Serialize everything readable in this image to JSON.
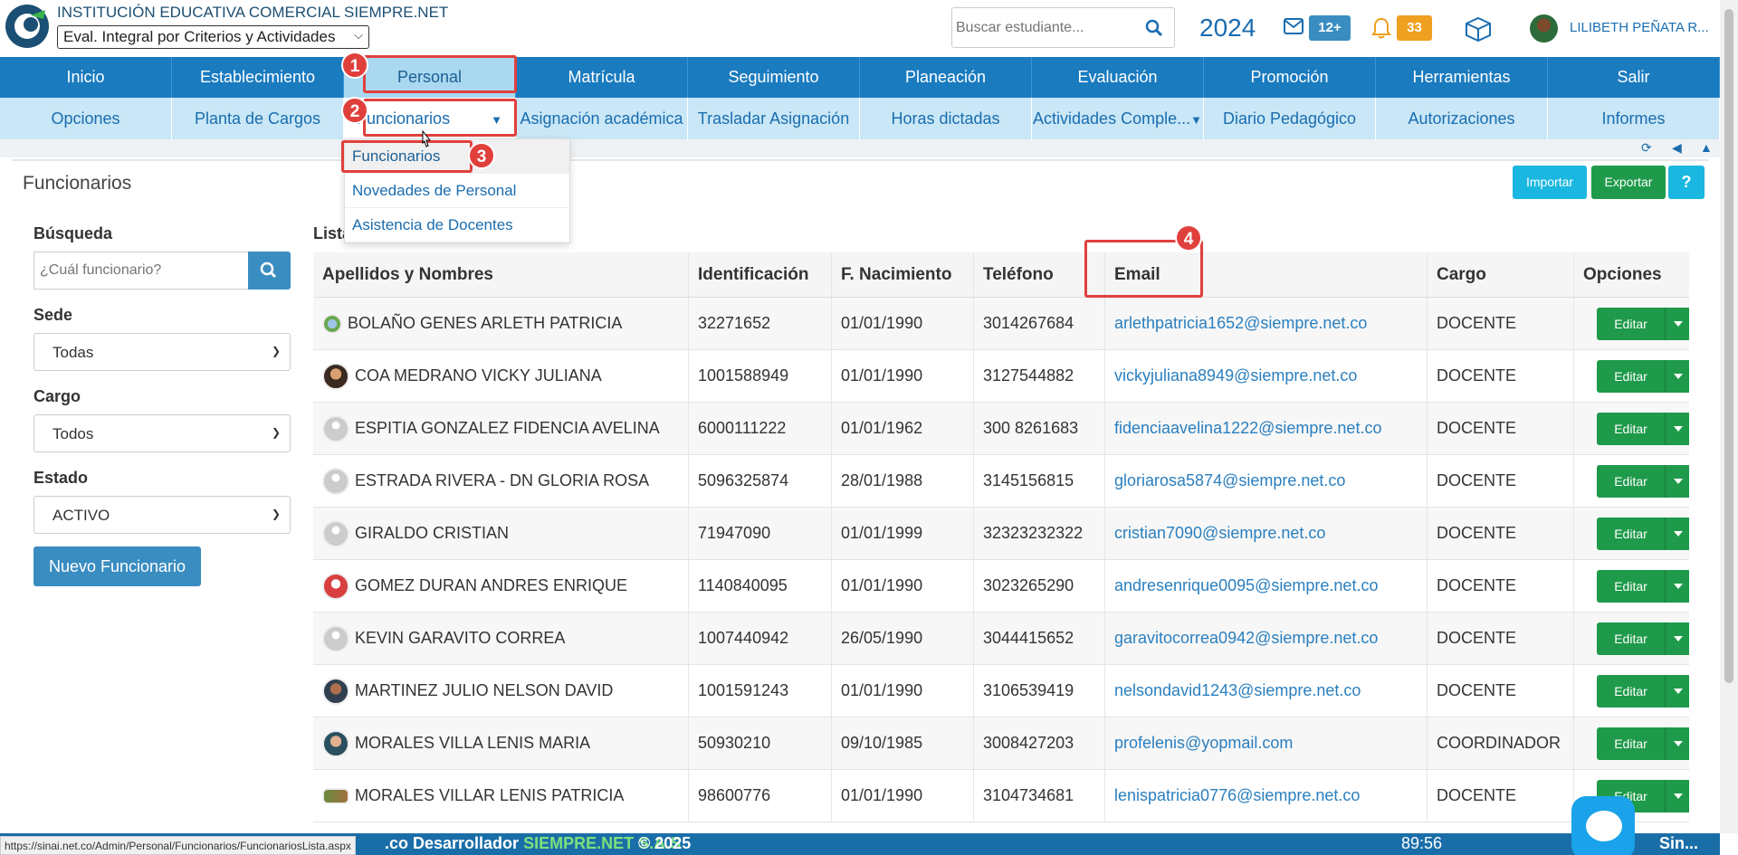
{
  "header": {
    "institution": "INSTITUCIÓN EDUCATIVA COMERCIAL SIEMPRE.NET",
    "year_select": "Eval. Integral por Criterios y Actividades",
    "search_placeholder": "Buscar estudiante...",
    "year": "2024",
    "mail_count": "12+",
    "notif_count": "33",
    "user_name": "LILIBETH PEÑATA R..."
  },
  "nav": [
    "Inicio",
    "Establecimiento",
    "Personal",
    "Matrícula",
    "Seguimiento",
    "Planeación",
    "Evaluación",
    "Promoción",
    "Herramientas",
    "Salir"
  ],
  "subnav": [
    "Opciones",
    "Planta de Cargos",
    "Funcionarios",
    "Asignación académica",
    "Trasladar Asignación",
    "Horas dictadas",
    "Actividades Comple...",
    "Diario Pedagógico",
    "Autorizaciones",
    "Informes"
  ],
  "dropdown": [
    "Funcionarios",
    "Novedades de Personal",
    "Asistencia de Docentes"
  ],
  "page": {
    "title": "Funcionarios",
    "import": "Importar",
    "export": "Exportar",
    "help": "?",
    "list_label": "Lista",
    "search_label": "Búsqueda",
    "search_placeholder": "¿Cuál funcionario?",
    "sede_label": "Sede",
    "sede_value": "Todas",
    "cargo_label": "Cargo",
    "cargo_value": "Todos",
    "estado_label": "Estado",
    "estado_value": "ACTIVO",
    "new_button": "Nuevo Funcionario"
  },
  "table": {
    "headers": [
      "Apellidos y Nombres",
      "Identificación",
      "F. Nacimiento",
      "Teléfono",
      "Email",
      "Cargo",
      "Opciones"
    ],
    "edit_label": "Editar",
    "rows": [
      {
        "name": "BOLAÑO GENES ARLETH PATRICIA",
        "id": "32271652",
        "dob": "01/01/1990",
        "phone": "3014267684",
        "email": "arlethpatricia1652@siempre.net.co",
        "cargo": "DOCENTE"
      },
      {
        "name": "COA MEDRANO VICKY JULIANA",
        "id": "1001588949",
        "dob": "01/01/1990",
        "phone": "3127544882",
        "email": "vickyjuliana8949@siempre.net.co",
        "cargo": "DOCENTE"
      },
      {
        "name": "ESPITIA GONZALEZ FIDENCIA AVELINA",
        "id": "6000111222",
        "dob": "01/01/1962",
        "phone": "300 8261683",
        "email": "fidenciaavelina1222@siempre.net.co",
        "cargo": "DOCENTE"
      },
      {
        "name": "ESTRADA RIVERA - DN GLORIA ROSA",
        "id": "5096325874",
        "dob": "28/01/1988",
        "phone": "3145156815",
        "email": "gloriarosa5874@siempre.net.co",
        "cargo": "DOCENTE"
      },
      {
        "name": "GIRALDO CRISTIAN",
        "id": "71947090",
        "dob": "01/01/1999",
        "phone": "32323232322",
        "email": "cristian7090@siempre.net.co",
        "cargo": "DOCENTE"
      },
      {
        "name": "GOMEZ DURAN ANDRES ENRIQUE",
        "id": "1140840095",
        "dob": "01/01/1990",
        "phone": "3023265290",
        "email": "andresenrique0095@siempre.net.co",
        "cargo": "DOCENTE"
      },
      {
        "name": "KEVIN GARAVITO CORREA",
        "id": "1007440942",
        "dob": "26/05/1990",
        "phone": "3044415652",
        "email": "garavitocorrea0942@siempre.net.co",
        "cargo": "DOCENTE"
      },
      {
        "name": "MARTINEZ JULIO NELSON DAVID",
        "id": "1001591243",
        "dob": "01/01/1990",
        "phone": "3106539419",
        "email": "nelsondavid1243@siempre.net.co",
        "cargo": "DOCENTE"
      },
      {
        "name": "MORALES VILLA LENIS MARIA",
        "id": "50930210",
        "dob": "09/10/1985",
        "phone": "3008427203",
        "email": "profelenis@yopmail.com",
        "cargo": "COORDINADOR"
      },
      {
        "name": "MORALES VILLAR LENIS PATRICIA",
        "id": "98600776",
        "dob": "01/01/1990",
        "phone": "3104734681",
        "email": "lenispatricia0776@siempre.net.co",
        "cargo": "DOCENTE"
      }
    ]
  },
  "callouts": [
    "1",
    "2",
    "3",
    "4"
  ],
  "footer": {
    "dev_prefix": ".co Desarrollador ",
    "dev_company": "SIEMPRE.NET S.A.S",
    "copyright": "© 2025",
    "timer": "89:56",
    "brand": "Sin..."
  },
  "status_url": "https://sinai.net.co/Admin/Personal/Funcionarios/FuncionariosLista.aspx",
  "colors": {
    "nav": "#1a7bbf",
    "subnav": "#c9e7f6",
    "accent": "#e0403c",
    "green": "#1e9a4a"
  }
}
